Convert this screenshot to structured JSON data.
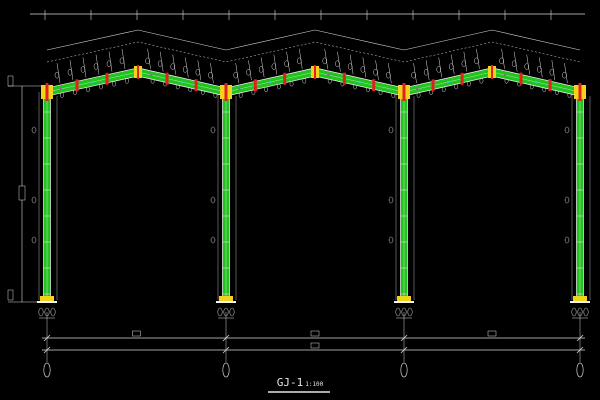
{
  "drawing": {
    "title_main": "GJ-1",
    "title_scale": "1:100"
  },
  "colors": {
    "background": "#000000",
    "frame": "#22c21f",
    "frame_outline": "#f2f2f2",
    "dimension": "#d9d9d9",
    "axis_line": "#cfcfcf",
    "joint_yellow": "#f3d21b",
    "joint_red": "#e12020",
    "accent_cyan": "#2bc8d6",
    "accent_magenta": "#c43bd6"
  },
  "structure": {
    "type": "multi-span portal steel frame elevation",
    "spans": 3,
    "columns": 4,
    "gable_ridges": 3
  }
}
